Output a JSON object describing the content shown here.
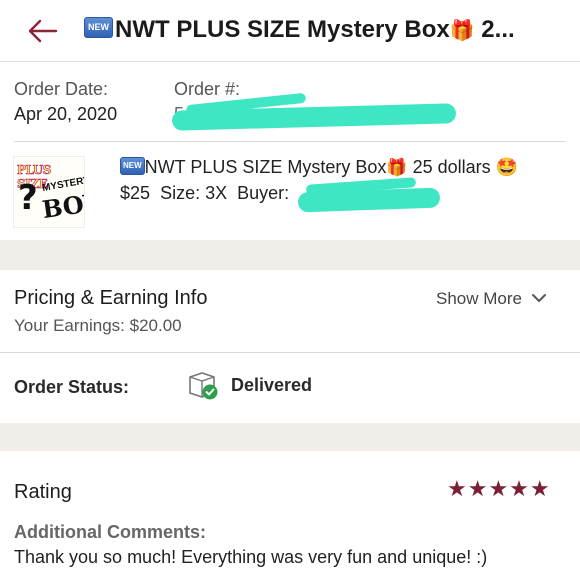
{
  "header": {
    "badge": "NEW",
    "title": "NWT PLUS SIZE Mystery Box",
    "title_tail": " 2...",
    "back_icon": "back-arrow-icon"
  },
  "order": {
    "date_label": "Order Date:",
    "date_value": "Apr 20, 2020",
    "number_label": "Order #:",
    "number_value": "5e0df6"
  },
  "item": {
    "badge": "NEW",
    "title": "NWT PLUS SIZE Mystery Box",
    "title_suffix": " 25 dollars ",
    "emoji": "🤩",
    "price": "$25",
    "size": "Size: 3X",
    "buyer_label": "Buyer:",
    "thumb": {
      "line1": "PLUS SIZE",
      "line2": "?",
      "line3": "MYSTERY",
      "line4": "BOX"
    }
  },
  "pricing": {
    "title": "Pricing & Earning Info",
    "earnings": "Your Earnings: $20.00",
    "show_more": "Show More"
  },
  "status": {
    "label": "Order Status:",
    "value": "Delivered"
  },
  "rating": {
    "title": "Rating",
    "stars": 5,
    "stars_text": "★★★★★",
    "comments_label": "Additional Comments:",
    "comment": "Thank you so much! Everything was very fun and unique! :)"
  },
  "colors": {
    "accent": "#7a1f36",
    "band": "#f1ede9",
    "redaction": "#3fe6c3",
    "delivered": "#2e9e4f"
  }
}
